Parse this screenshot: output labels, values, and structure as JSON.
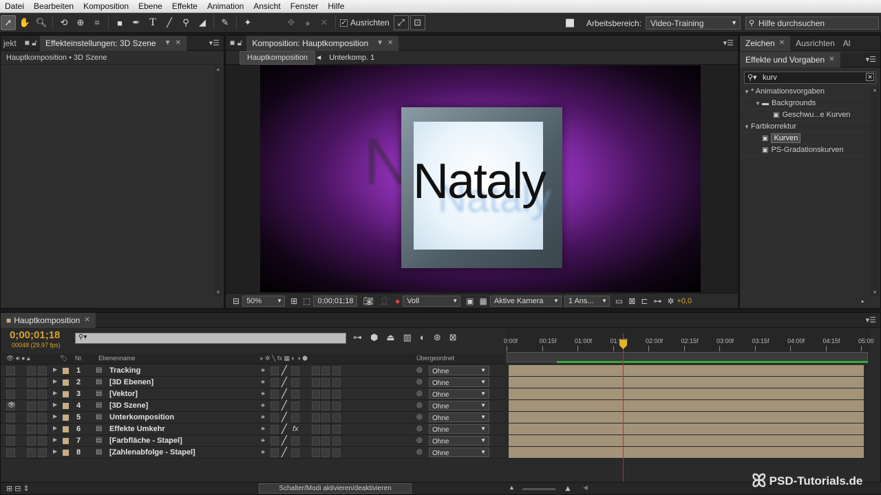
{
  "menu": [
    "Datei",
    "Bearbeiten",
    "Komposition",
    "Ebene",
    "Effekte",
    "Animation",
    "Ansicht",
    "Fenster",
    "Hilfe"
  ],
  "toolbar": {
    "snap_label": "Ausrichten",
    "workspace_label": "Arbeitsbereich:",
    "workspace_value": "Video-Training",
    "help_search_placeholder": "Hilfe durchsuchen"
  },
  "effects_panel": {
    "tab_left": "jekt",
    "tab": "Effekteinstellungen: 3D Szene",
    "subtitle": "Hauptkomposition • 3D Szene"
  },
  "comp_panel": {
    "tab": "Komposition: Hauptkomposition",
    "crumbs": [
      "Hauptkomposition",
      "Unterkomp. 1"
    ],
    "text": "Nataly",
    "bottom": {
      "zoom": "50%",
      "timecode": "0;00;01;18",
      "resolution": "Voll",
      "camera": "Aktive Kamera",
      "views": "1 Ans...",
      "exposure": "+0,0"
    }
  },
  "presets_panel": {
    "tabs_top": [
      "Zeichen",
      "Ausrichten",
      "Al"
    ],
    "tab": "Effekte und Vorgaben",
    "search_value": "kurv",
    "tree": [
      {
        "label": "* Animationsvorgaben",
        "level": 0,
        "type": "folder-open"
      },
      {
        "label": "Backgrounds",
        "level": 1,
        "type": "folder"
      },
      {
        "label": "Geschwu...e Kurven",
        "level": 2,
        "type": "preset"
      },
      {
        "label": "Farbkorrektur",
        "level": 0,
        "type": "folder-open"
      },
      {
        "label": "Kurven",
        "level": 1,
        "type": "effect",
        "selected": true
      },
      {
        "label": "PS-Gradationskurven",
        "level": 1,
        "type": "effect"
      }
    ]
  },
  "timeline": {
    "tab": "Hauptkomposition",
    "timecode": "0;00;01;18",
    "fps": "00048 (29.97 fps)",
    "col_nr": "Nr.",
    "col_name": "Ebenenname",
    "col_parent": "Übergeordnet",
    "ruler_ticks": [
      "0:00f",
      "00:15f",
      "01:00f",
      "01:15f",
      "02:00f",
      "02:15f",
      "03:00f",
      "03:15f",
      "04:00f",
      "04:15f",
      "05:00"
    ],
    "layers": [
      {
        "nr": "1",
        "name": "Tracking",
        "parent": "Ohne",
        "eye": false,
        "fx": false
      },
      {
        "nr": "2",
        "name": "[3D Ebenen]",
        "parent": "Ohne",
        "eye": false,
        "fx": false
      },
      {
        "nr": "3",
        "name": "[Vektor]",
        "parent": "Ohne",
        "eye": false,
        "fx": false
      },
      {
        "nr": "4",
        "name": "[3D Szene]",
        "parent": "Ohne",
        "eye": true,
        "fx": false
      },
      {
        "nr": "5",
        "name": "Unterkomposition",
        "parent": "Ohne",
        "eye": false,
        "fx": false
      },
      {
        "nr": "6",
        "name": "Effekte Umkehr",
        "parent": "Ohne",
        "eye": false,
        "fx": true
      },
      {
        "nr": "7",
        "name": "[Farbfläche - Stapel]",
        "parent": "Ohne",
        "eye": false,
        "fx": false
      },
      {
        "nr": "8",
        "name": "[Zahlenabfolge - Stapel]",
        "parent": "Ohne",
        "eye": false,
        "fx": false
      }
    ],
    "toggle_label": "Schalter/Modi aktivieren/deaktivieren"
  },
  "watermark": "PSD-Tutorials.de",
  "colors": {
    "timecode": "#d8a430",
    "playhead": "#dd2222",
    "track": "#a39379",
    "work_area": "#3ca83c"
  }
}
